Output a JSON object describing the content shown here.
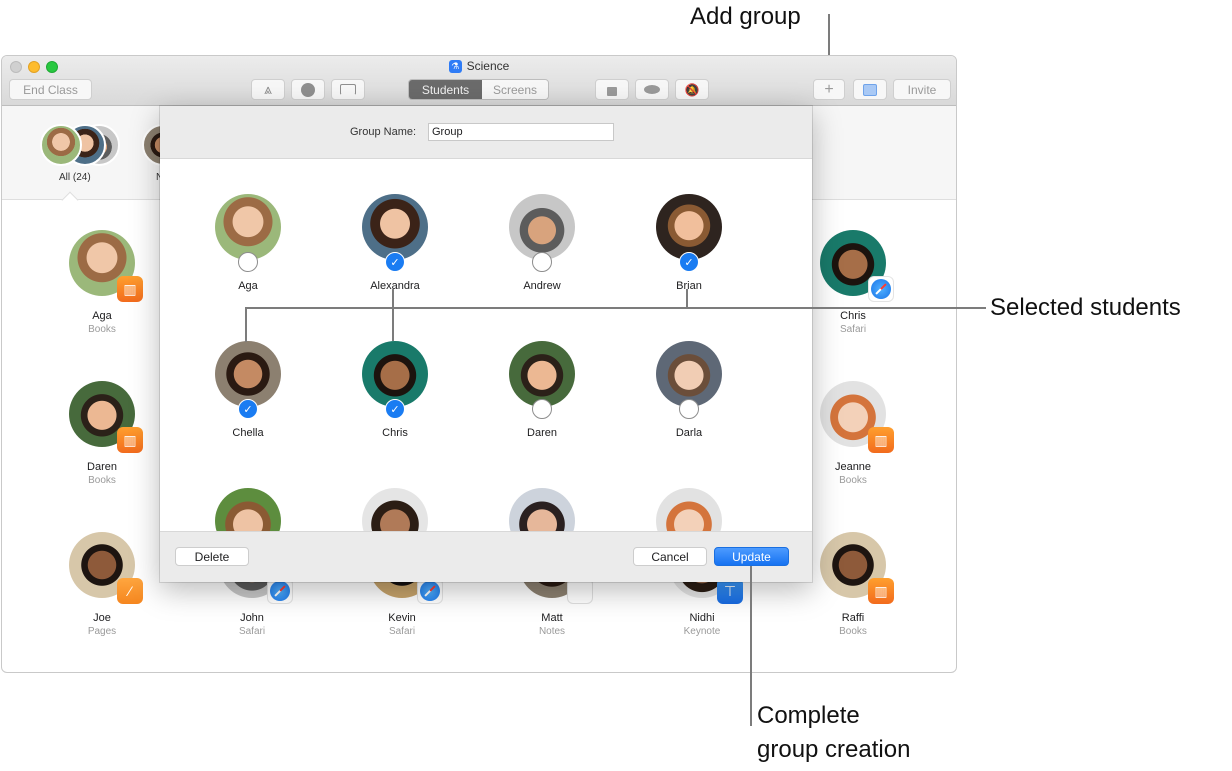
{
  "window": {
    "title": "Science",
    "app_icon": "microscope-icon"
  },
  "toolbar": {
    "end_class_label": "End Class",
    "open_app_icon": "app-store-icon",
    "navigate_icon": "compass-icon",
    "airplay_icon": "airplay-icon",
    "segments": [
      {
        "label": "Students",
        "active": true
      },
      {
        "label": "Screens",
        "active": false
      }
    ],
    "lock_icon": "lock-icon",
    "hide_icon": "eye-slash-icon",
    "mute_icon": "bell-slash-icon",
    "add_group_icon": "plus-icon",
    "inbox_icon": "inbox-icon",
    "invite_label": "Invite"
  },
  "groups_bar": {
    "all_label": "All (24)",
    "second_group_label_partial": "N"
  },
  "background_students": [
    {
      "name": "Aga",
      "app": "Books"
    },
    {
      "name": "Chris",
      "app": "Safari"
    },
    {
      "name": "Daren",
      "app": "Books"
    },
    {
      "name": "Jeanne",
      "app": "Books"
    },
    {
      "name": "Joe",
      "app": "Pages"
    },
    {
      "name": "John",
      "app": "Safari"
    },
    {
      "name": "Kevin",
      "app": "Safari"
    },
    {
      "name": "Matt",
      "app": "Notes"
    },
    {
      "name": "Nidhi",
      "app": "Keynote"
    },
    {
      "name": "Raffi",
      "app": "Books"
    }
  ],
  "sheet": {
    "group_name_label": "Group Name:",
    "group_name_value": "Group",
    "students": [
      {
        "name": "Aga",
        "selected": false
      },
      {
        "name": "Alexandra",
        "selected": true
      },
      {
        "name": "Andrew",
        "selected": false
      },
      {
        "name": "Brian",
        "selected": true
      },
      {
        "name": "Chella",
        "selected": true
      },
      {
        "name": "Chris",
        "selected": true
      },
      {
        "name": "Daren",
        "selected": false
      },
      {
        "name": "Darla",
        "selected": false
      },
      {
        "name": "",
        "selected": false
      },
      {
        "name": "",
        "selected": false
      },
      {
        "name": "",
        "selected": false
      },
      {
        "name": "",
        "selected": false
      }
    ],
    "delete_label": "Delete",
    "cancel_label": "Cancel",
    "update_label": "Update",
    "check_glyph": "✓"
  },
  "callouts": {
    "add_group": "Add group",
    "selected_students": "Selected students",
    "complete_line1": "Complete",
    "complete_line2": "group creation"
  },
  "colors": {
    "accent_blue": "#1a7cf2",
    "books_orange": "#f5821f",
    "traffic_yellow": "#febc2e",
    "traffic_green": "#28c840"
  }
}
